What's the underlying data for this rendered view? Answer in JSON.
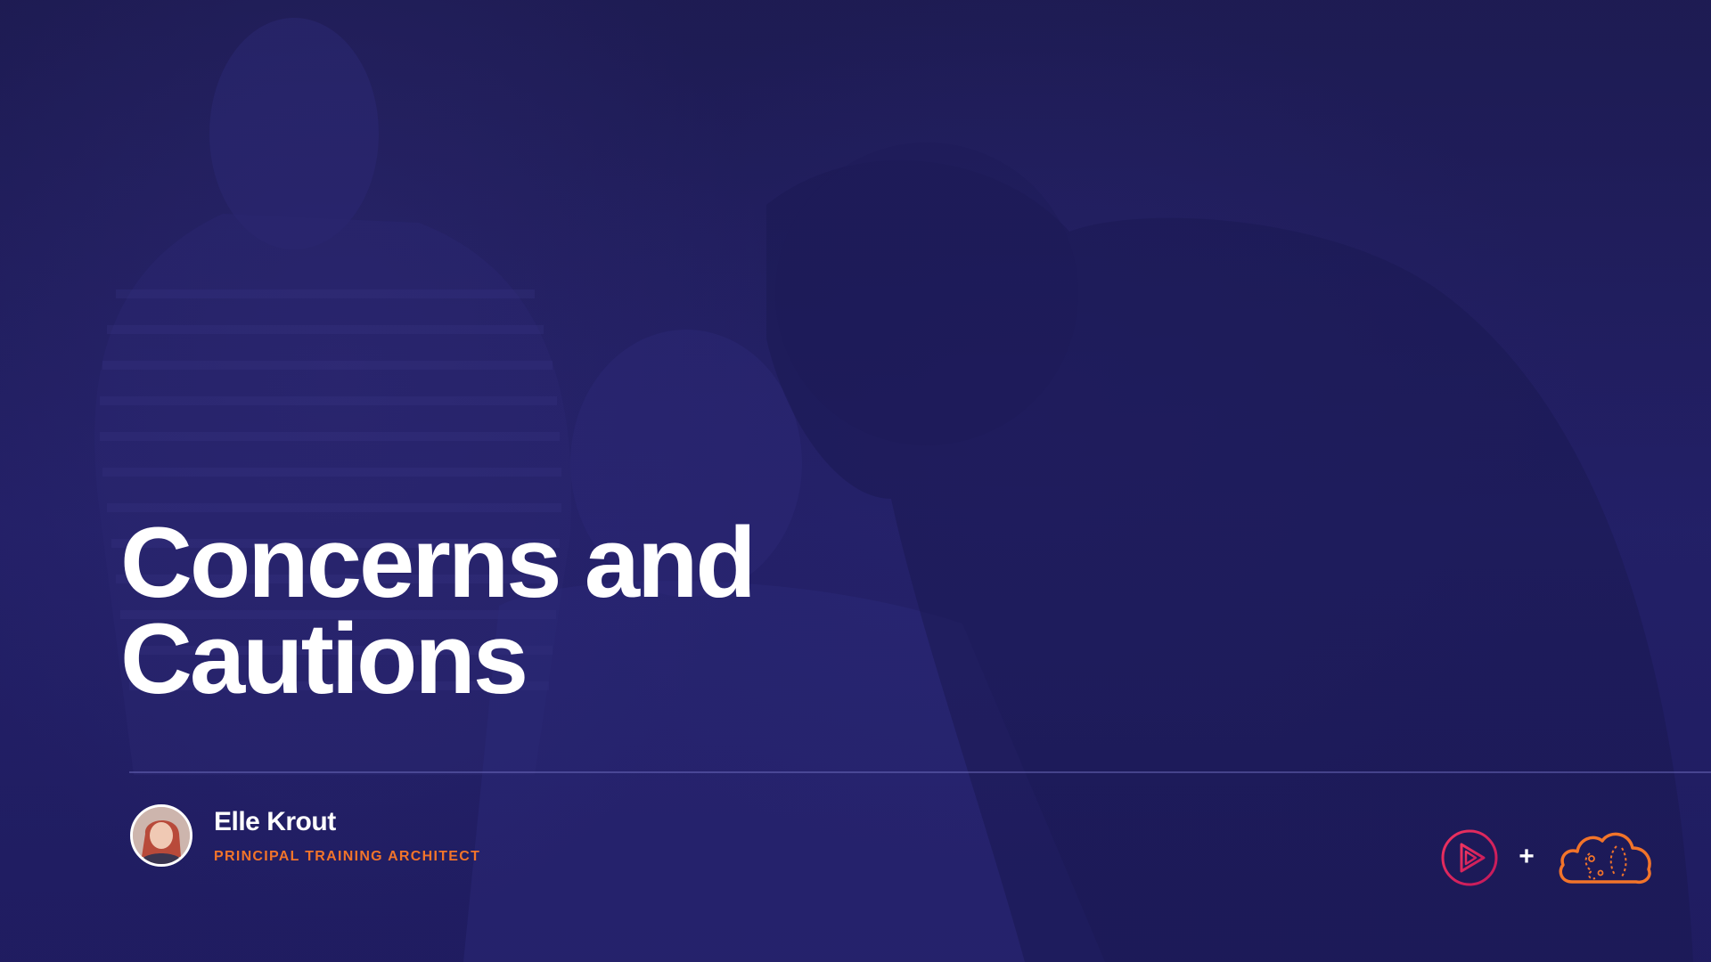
{
  "slide": {
    "title_lines": [
      "Concerns and",
      "Cautions"
    ]
  },
  "presenter": {
    "name": "Elle Krout",
    "role": "PRINCIPAL TRAINING ARCHITECT"
  },
  "logos": {
    "plus_sign": "+",
    "left_logo_icon": "play-logo-icon",
    "right_logo_icon": "cloud-logo-icon"
  },
  "colors": {
    "background": "#1f1c5f",
    "accent_orange": "#f2742a",
    "accent_pink": "#e3265a",
    "text": "#ffffff"
  }
}
